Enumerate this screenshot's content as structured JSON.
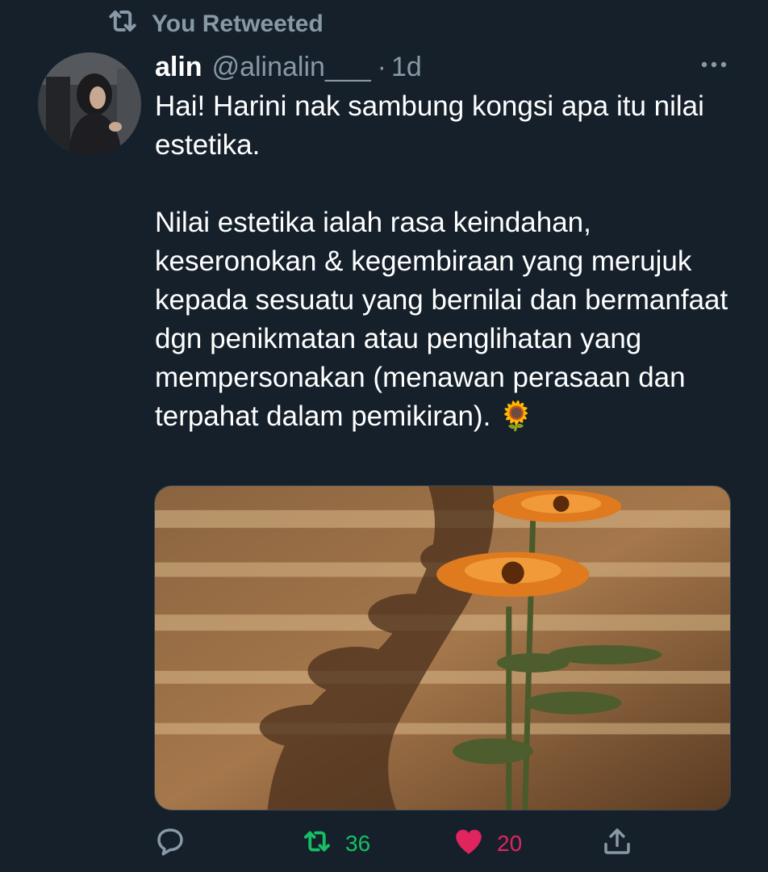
{
  "retweet_banner": {
    "label": "You Retweeted",
    "icon": "retweet-icon"
  },
  "tweet": {
    "author": {
      "name": "alin",
      "handle": "@alinalin___",
      "time": "1d",
      "separator": "·"
    },
    "paragraphs": [
      "Hai! Harini nak sambung kongsi apa itu nilai estetika.",
      "Nilai estetika ialah rasa keindahan, keseronokan & kegembiraan yang merujuk kepada sesuatu yang bernilai dan bermanfaat dgn penikmatan atau penglihatan yang mempersonakan (menawan perasaan dan terpahat dalam pemikiran). 🌻"
    ],
    "media": {
      "description_icon": "photo-flowers"
    },
    "actions": {
      "reply_count": "",
      "retweet_count": "36",
      "like_count": "20"
    }
  },
  "colors": {
    "background": "#15202b",
    "muted": "#8899a6",
    "retweet_green": "#17bf63",
    "like_red": "#e0245e"
  }
}
